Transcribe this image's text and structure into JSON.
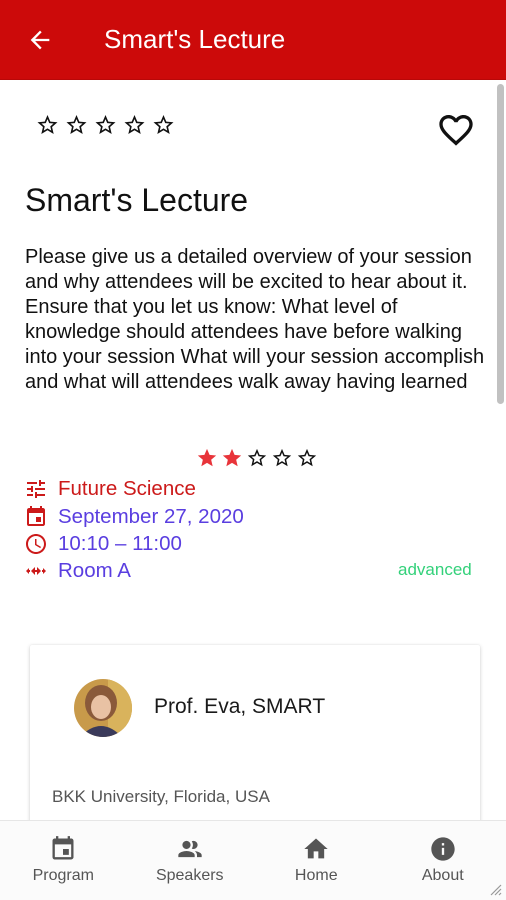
{
  "appbar": {
    "title": "Smart's Lecture"
  },
  "session": {
    "title": "Smart's Lecture",
    "description": "Please give us a detailed overview of your session and why attendees will be excited to hear about it.   Ensure that you let us know: What level of knowledge should attendees have before walking into your session What will your session accomplish and what will attendees walk away having learned",
    "user_rating": 0,
    "rating": 2,
    "rating_max": 5,
    "track": "Future Science",
    "date": "September 27, 2020",
    "time": "10:10 – 11:00",
    "room": "Room A",
    "level": "advanced"
  },
  "speaker": {
    "name": "Prof. Eva, SMART",
    "affiliation": "BKK University, Florida, USA"
  },
  "nav": {
    "items": [
      {
        "label": "Program",
        "icon": "calendar-icon"
      },
      {
        "label": "Speakers",
        "icon": "people-icon"
      },
      {
        "label": "Home",
        "icon": "home-icon"
      },
      {
        "label": "About",
        "icon": "info-icon"
      }
    ]
  },
  "colors": {
    "appbar": "#cc0a0a",
    "track": "#cc1a1a",
    "meta": "#5a3ee0",
    "level": "#33d17a",
    "star_filled": "#e8343a"
  }
}
